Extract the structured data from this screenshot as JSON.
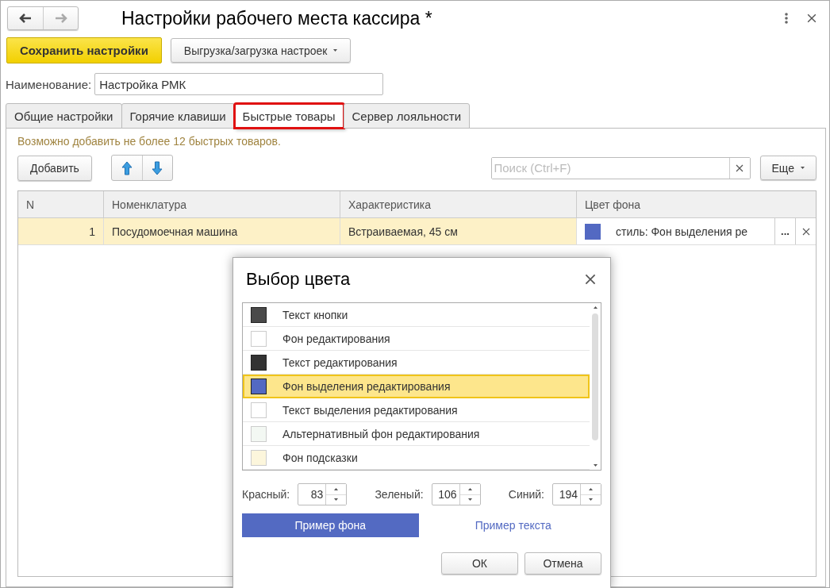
{
  "window": {
    "title": "Настройки рабочего места кассира *"
  },
  "toolbar": {
    "save": "Сохранить настройки",
    "export": "Выгрузка/загрузка настроек"
  },
  "name_field": {
    "label": "Наименование:",
    "value": "Настройка РМК"
  },
  "tabs": [
    {
      "label": "Общие настройки",
      "selected": false
    },
    {
      "label": "Горячие клавиши",
      "selected": false
    },
    {
      "label": "Быстрые товары",
      "selected": true
    },
    {
      "label": "Сервер лояльности",
      "selected": false
    }
  ],
  "hint": "Возможно добавить не более 12 быстрых товаров.",
  "list_toolbar": {
    "add": "Добавить",
    "search_placeholder": "Поиск (Ctrl+F)",
    "more": "Еще"
  },
  "table": {
    "columns": [
      "N",
      "Номенклатура",
      "Характеристика",
      "Цвет фона"
    ],
    "rows": [
      {
        "n": "1",
        "item": "Посудомоечная машина",
        "variant": "Встраиваемая, 45 см",
        "color": "#5369c2",
        "color_text": "стиль: Фон выделения ре",
        "select_label": "...",
        "selected": true
      }
    ]
  },
  "dialog": {
    "title": "Выбор цвета",
    "colors": [
      {
        "label": "Текст кнопки",
        "color": "#4a4a4a",
        "selected": false
      },
      {
        "label": "Фон редактирования",
        "color": "#ffffff",
        "selected": false
      },
      {
        "label": "Текст редактирования",
        "color": "#333333",
        "selected": false
      },
      {
        "label": "Фон выделения редактирования",
        "color": "#5369c2",
        "selected": true
      },
      {
        "label": "Текст выделения редактирования",
        "color": "#ffffff",
        "selected": false
      },
      {
        "label": "Альтернативный фон редактирования",
        "color": "#f3f8f3",
        "selected": false
      },
      {
        "label": "Фон подсказки",
        "color": "#fcf6dc",
        "selected": false
      }
    ],
    "channels": [
      {
        "label": "Красный:",
        "value": "83"
      },
      {
        "label": "Зеленый:",
        "value": "106"
      },
      {
        "label": "Синий:",
        "value": "194"
      }
    ],
    "sample_background": "Пример фона",
    "sample_text": "Пример текста",
    "buttons": [
      "ОК",
      "Отмена"
    ]
  }
}
